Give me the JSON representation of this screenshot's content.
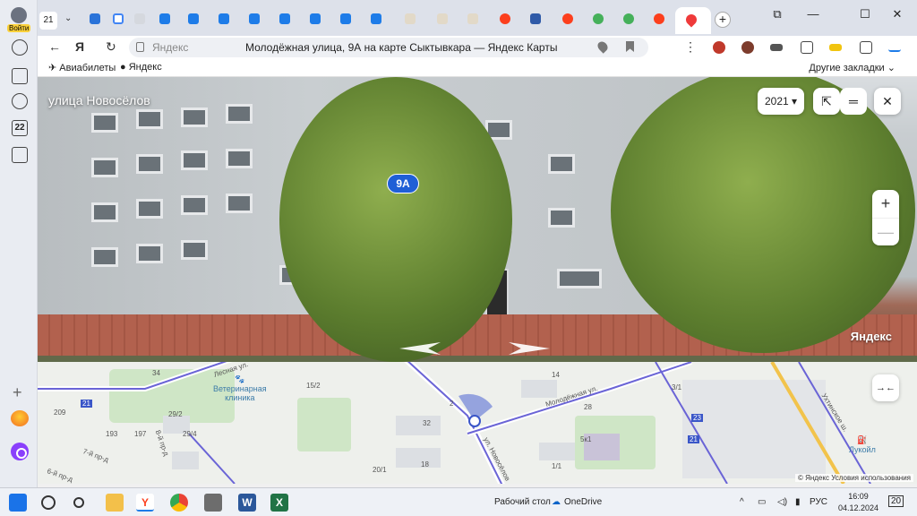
{
  "rail": {
    "login_label": "Войти",
    "bookmarks_count": "22"
  },
  "tabs": {
    "count": "21"
  },
  "window": {
    "minimize": "—",
    "maximize": "☐",
    "close": "✕"
  },
  "address": {
    "host": "Яндекс",
    "title": "Молодёжная улица, 9А на карте Сыктывкара — Яндекс Карты"
  },
  "bookmarks": {
    "items": [
      "Авиабилеты",
      "Яндекс"
    ],
    "other": "Другие закладки"
  },
  "panorama": {
    "street_name": "улица Новосёлов",
    "house_label": "9А",
    "year": "2021",
    "watermark": "Яндекс",
    "zoom_in": "+",
    "zoom_out": "—"
  },
  "map": {
    "poi_vet": "Ветеринарная\nклиника",
    "poi_lukoil": "Лукойл",
    "street_lesnaya": "Лесная ул.",
    "street_molodezhnaya": "Молодёжная ул.",
    "street_novoselov": "ул. Новосёлов",
    "street_ukhtinskoe": "Ухтинское ш.",
    "street_7pr": "7-й пр-д",
    "street_6pr": "6-й пр-д",
    "street_8pr": "8-й пр-д",
    "house_numbers": [
      "34",
      "15/2",
      "209",
      "29/2",
      "193",
      "197",
      "29/4",
      "32",
      "18",
      "20/1",
      "1/1",
      "3/1",
      "14",
      "2",
      "21",
      "21",
      "5к1",
      "23",
      "28"
    ],
    "copyright": "© Яндекс  Условия использования"
  },
  "taskbar": {
    "desktop": "Рабочий стол",
    "onedrive": "OneDrive",
    "lang": "РУС",
    "time": "16:09",
    "date": "04.12.2024",
    "notifications": "20"
  }
}
